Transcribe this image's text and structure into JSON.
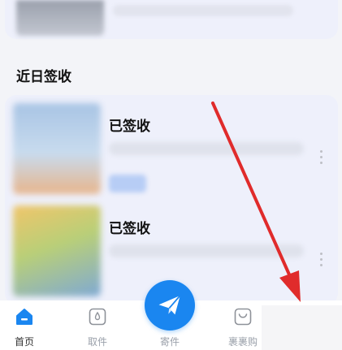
{
  "section": {
    "title": "近日签收"
  },
  "packages": [
    {
      "status": "已签收"
    },
    {
      "status": "已签收"
    }
  ],
  "tabbar": {
    "home": "首页",
    "pickup": "取件",
    "send": "寄件",
    "shop": "裹裹购"
  },
  "colors": {
    "accent": "#1a86f0",
    "arrow": "#e02b2b"
  }
}
